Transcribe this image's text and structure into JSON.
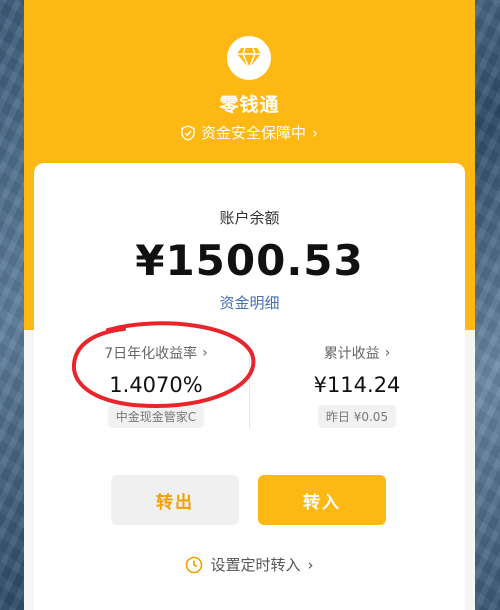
{
  "app": {
    "logo_icon": "diamond-icon",
    "title": "零钱通",
    "safety_label": "资金安全保障中",
    "safety_icon": "shield-check-icon"
  },
  "account": {
    "balance_label": "账户余额",
    "balance_value": "¥1500.53",
    "detail_link": "资金明细"
  },
  "yield": {
    "label": "7日年化收益率",
    "value": "1.4070%",
    "fund_name": "中金现金管家C"
  },
  "earnings": {
    "label": "累计收益",
    "value": "¥114.24",
    "yesterday": "昨日 ¥0.05"
  },
  "actions": {
    "transfer_out": "转出",
    "transfer_in": "转入"
  },
  "schedule": {
    "label": "设置定时转入",
    "icon": "clock-icon"
  },
  "colors": {
    "brand_yellow": "#fdb813",
    "link_blue": "#4470b8",
    "annotation_red": "#e8252b"
  }
}
